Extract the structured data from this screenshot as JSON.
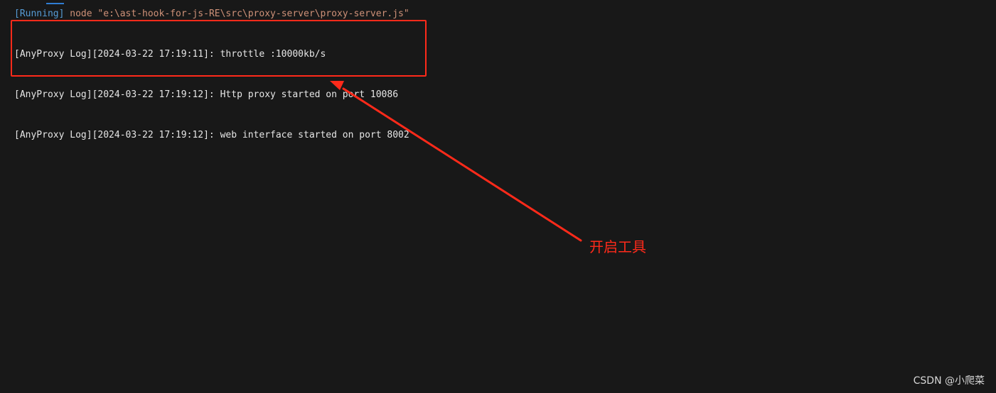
{
  "command": {
    "status": "[Running]",
    "text": " node \"e:\\ast-hook-for-js-RE\\src\\proxy-server\\proxy-server.js\""
  },
  "logs": [
    "[AnyProxy Log][2024-03-22 17:19:11]: throttle :10000kb/s",
    "[AnyProxy Log][2024-03-22 17:19:12]: Http proxy started on port 10086",
    "[AnyProxy Log][2024-03-22 17:19:12]: web interface started on port 8002"
  ],
  "annotation": {
    "label": "开启工具",
    "color": "#ff2a1a"
  },
  "watermark": "CSDN @小爬菜",
  "colors": {
    "background": "#181818",
    "running": "#569cd6",
    "command_text": "#ce9178",
    "log_text": "#e6e6e6"
  }
}
